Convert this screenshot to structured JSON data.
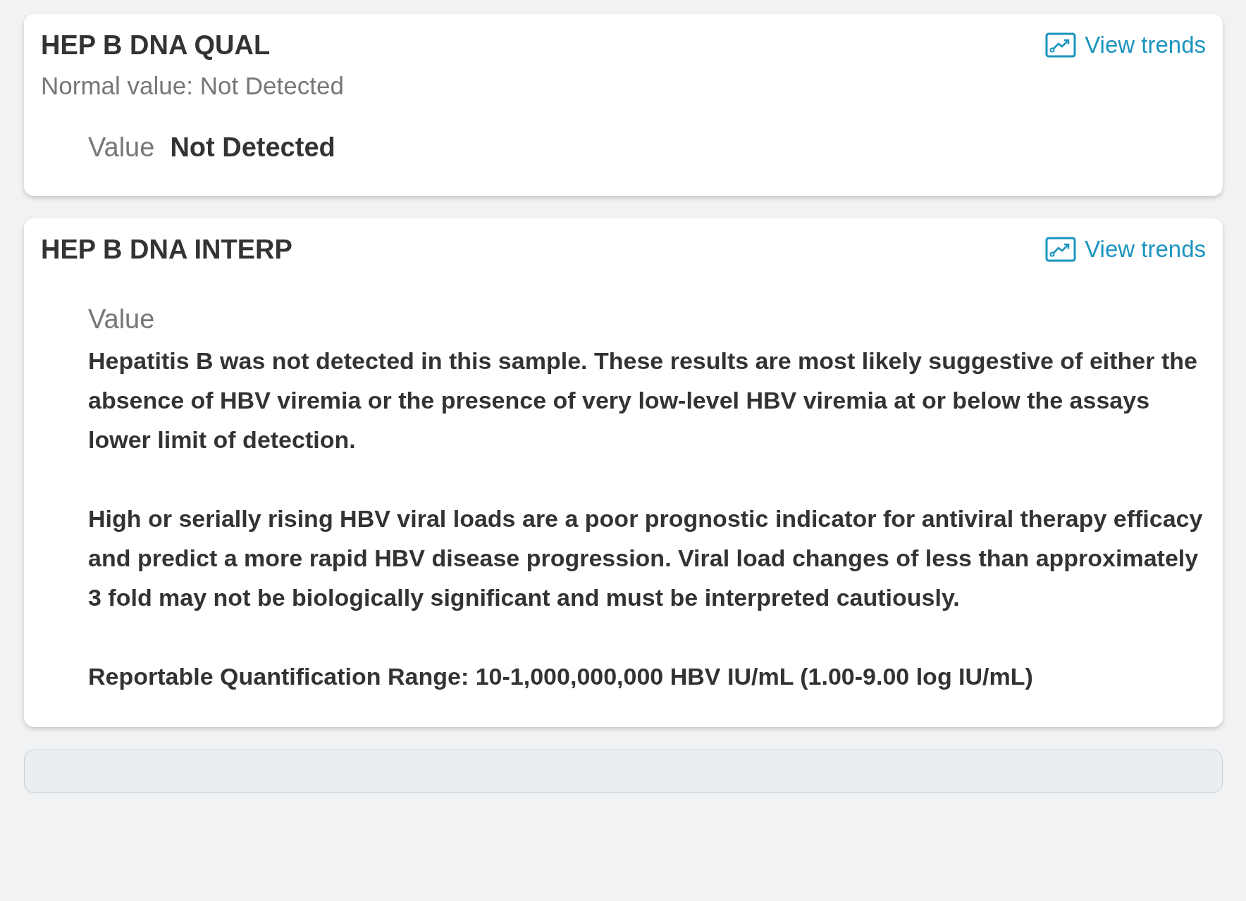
{
  "cards": [
    {
      "kind": "inline",
      "title": "HEP B DNA QUAL",
      "normal_value": "Normal value: Not Detected",
      "trends_link": "View trends",
      "value_label": "Value",
      "value": [
        "Not Detected"
      ]
    },
    {
      "kind": "stacked",
      "title": "HEP B DNA INTERP",
      "trends_link": "View trends",
      "value_label": "Value",
      "value": [
        "Hepatitis B was not detected in this sample. These results are most likely suggestive of either the absence of HBV viremia or the presence of very low-level HBV viremia at or below the assays lower limit of detection.",
        "High or serially rising HBV viral loads are a poor prognostic indicator for antiviral therapy efficacy and predict a more rapid HBV disease progression. Viral load changes of less than approximately 3 fold may not be biologically significant and must be interpreted cautiously.",
        "Reportable Quantification Range: 10-1,000,000,000 HBV IU/mL (1.00-9.00 log IU/mL)"
      ]
    },
    {
      "kind": "collapsed"
    }
  ]
}
